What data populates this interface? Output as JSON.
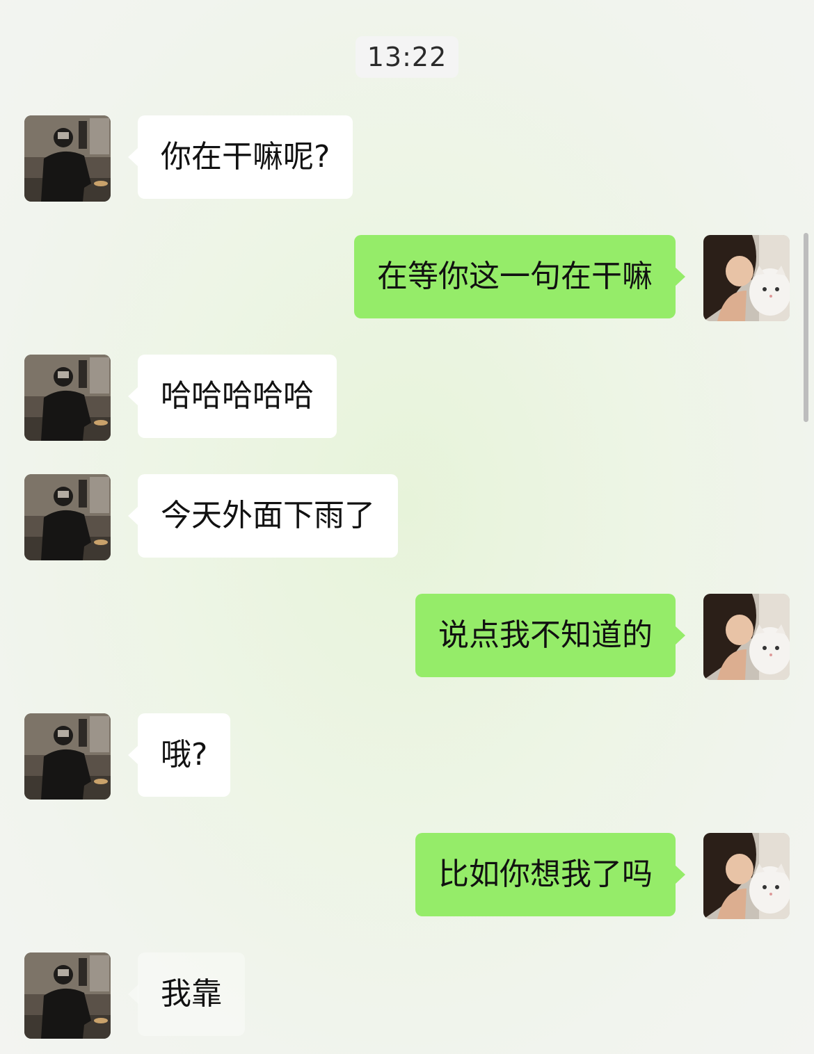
{
  "chat": {
    "timestamp": "13:22",
    "messages": [
      {
        "side": "in",
        "text": "你在干嘛呢?"
      },
      {
        "side": "out",
        "text": "在等你这一句在干嘛"
      },
      {
        "side": "in",
        "text": "哈哈哈哈哈"
      },
      {
        "side": "in",
        "text": "今天外面下雨了"
      },
      {
        "side": "out",
        "text": "说点我不知道的"
      },
      {
        "side": "in",
        "text": "哦?"
      },
      {
        "side": "out",
        "text": "比如你想我了吗"
      },
      {
        "side": "in",
        "text": "我靠"
      }
    ]
  },
  "colors": {
    "outgoing_bubble": "#95ec69",
    "incoming_bubble": "#ffffff"
  },
  "icons": {
    "contact_avatar": "person-photo-avatar",
    "self_avatar": "girl-with-cat-photo-avatar"
  }
}
